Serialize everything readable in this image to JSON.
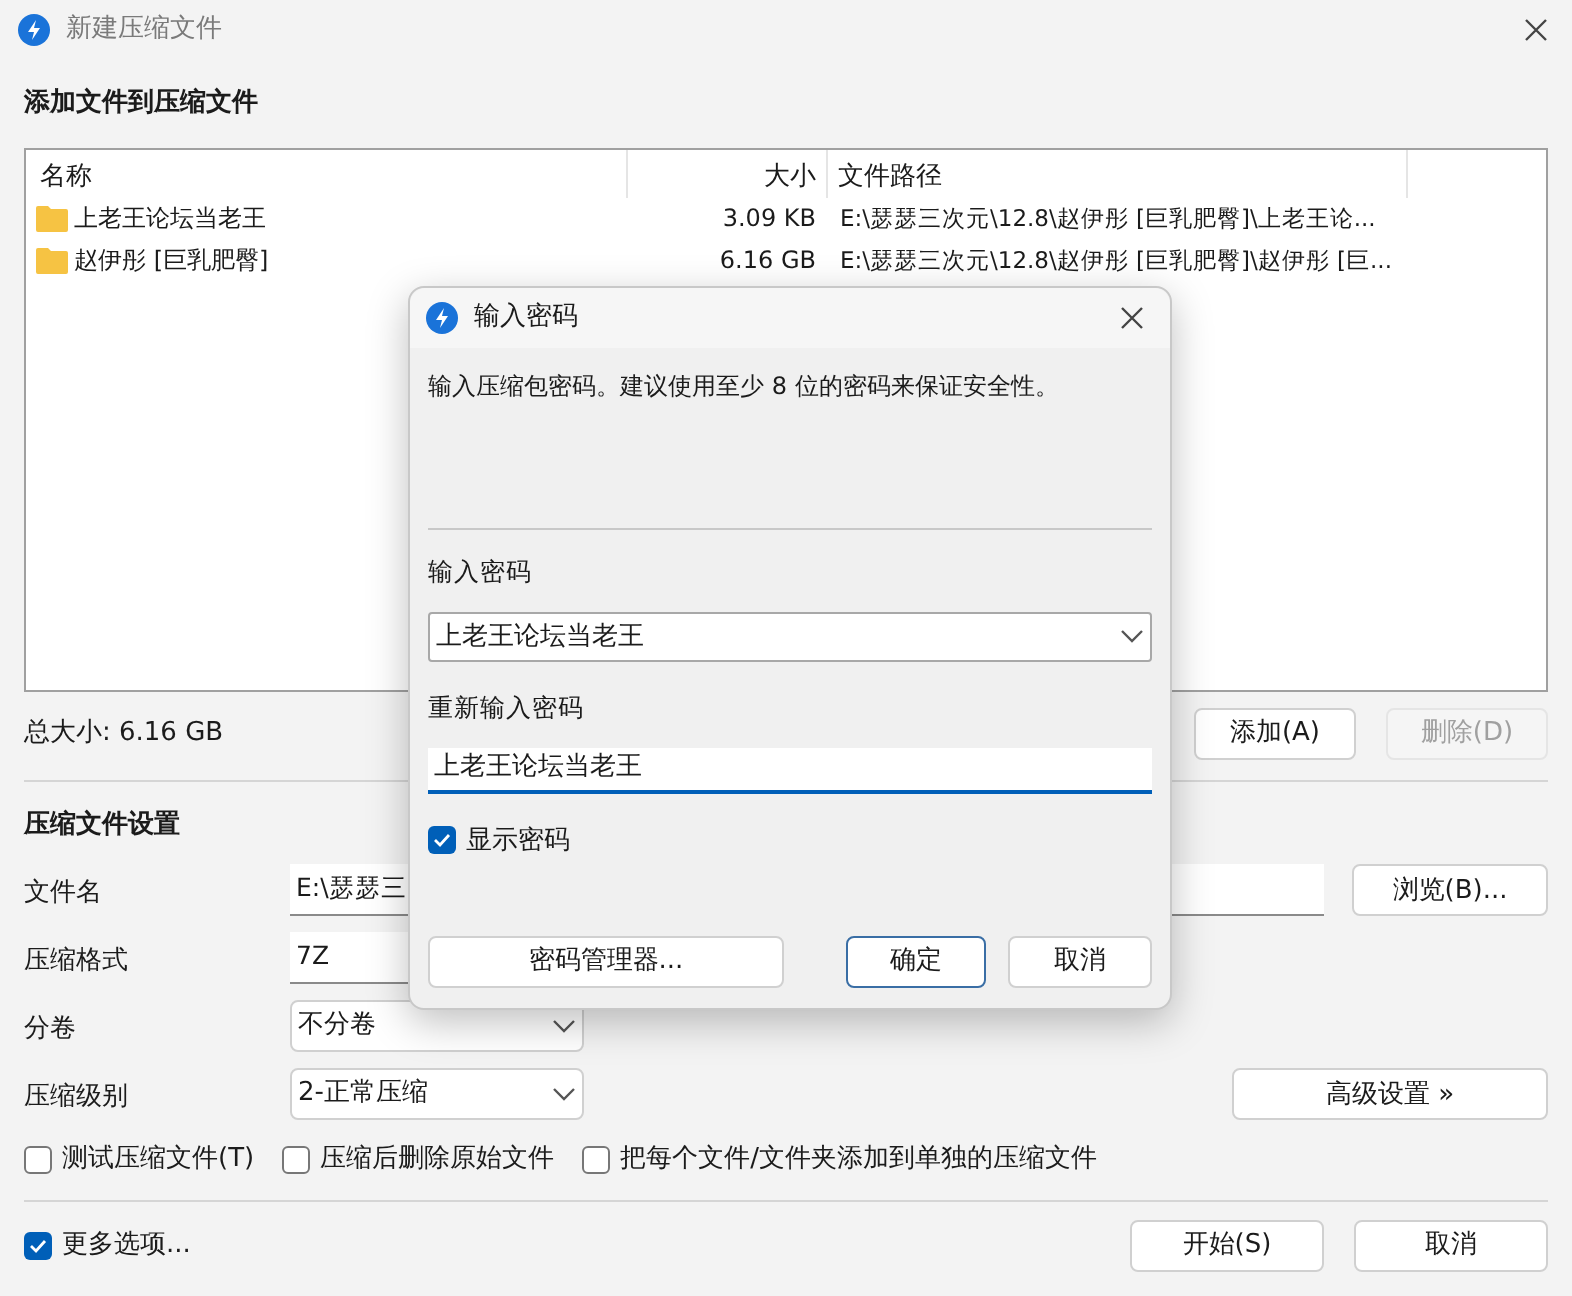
{
  "window": {
    "title": "新建压缩文件"
  },
  "files_section": {
    "heading": "添加文件到压缩文件"
  },
  "file_list": {
    "columns": [
      "名称",
      "大小",
      "文件路径"
    ],
    "rows": [
      {
        "name": "上老王论坛当老王",
        "size": "3.09 KB",
        "path": "E:\\瑟瑟三次元\\12.8\\赵伊彤 [巨乳肥臀]\\上老王论..."
      },
      {
        "name": "赵伊彤 [巨乳肥臀]",
        "size": "6.16 GB",
        "path": "E:\\瑟瑟三次元\\12.8\\赵伊彤 [巨乳肥臀]\\赵伊彤 [巨..."
      }
    ]
  },
  "total_size": "总大小: 6.16 GB",
  "list_buttons": [
    {
      "label": "添加(A)",
      "disabled": false
    },
    {
      "label": "删除(D)",
      "disabled": true
    }
  ],
  "settings": {
    "heading": "压缩文件设置",
    "fields": [
      {
        "kind": "text",
        "label": "文件名",
        "value": "E:\\瑟瑟三",
        "button": "浏览(B)..."
      },
      {
        "kind": "text",
        "label": "压缩格式",
        "value": "7Z"
      },
      {
        "kind": "select",
        "label": "分卷",
        "value": "不分卷"
      },
      {
        "kind": "select",
        "label": "压缩级别",
        "value": "2-正常压缩",
        "button": "高级设置 »"
      }
    ],
    "options": [
      {
        "label": "测试压缩文件(T)",
        "checked": false
      },
      {
        "label": "压缩后删除原始文件",
        "checked": false
      },
      {
        "label": "把每个文件/文件夹添加到单独的压缩文件",
        "checked": false
      }
    ]
  },
  "more_options": {
    "label": "更多选项...",
    "checked": true
  },
  "footer_buttons": [
    "开始(S)",
    "取消"
  ],
  "dialog": {
    "title": "输入密码",
    "message": "输入压缩包密码。建议使用至少 8 位的密码来保证安全性。",
    "password_label": "输入密码",
    "password": "上老王论坛当老王",
    "reenter_label": "重新输入密码",
    "reenter": "上老王论坛当老王",
    "show_password": {
      "label": "显示密码",
      "checked": true
    },
    "manager_button": "密码管理器...",
    "ok_button": "确定",
    "cancel_button": "取消"
  }
}
